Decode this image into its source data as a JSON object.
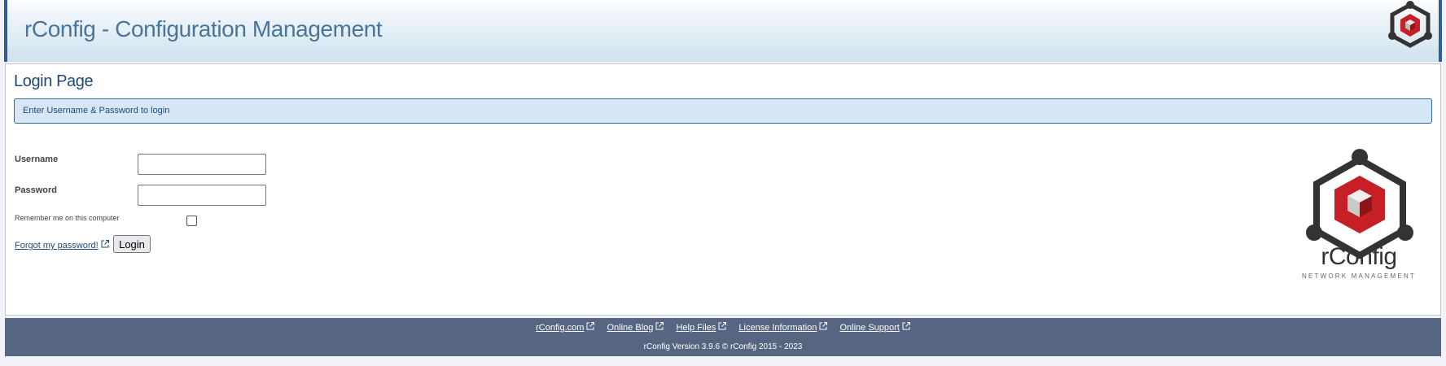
{
  "header": {
    "title": "rConfig - Configuration Management",
    "logo_icon": "rconfig-hexagon-logo-icon"
  },
  "login": {
    "page_title": "Login Page",
    "info_message": "Enter Username & Password to login",
    "username_label": "Username",
    "username_value": "",
    "password_label": "Password",
    "password_value": "",
    "remember_label": "Remember me on this computer",
    "remember_checked": false,
    "forgot_link": "Forgot my password!",
    "login_button": "Login",
    "logo_word": "rConfig",
    "logo_subtitle": "NETWORK MANAGEMENT"
  },
  "footer": {
    "links": [
      {
        "label": "rConfig.com"
      },
      {
        "label": "Online Blog"
      },
      {
        "label": "Help Files"
      },
      {
        "label": "License Information"
      },
      {
        "label": "Online Support"
      }
    ],
    "version_text": "rConfig Version 3.9.6   © rConfig 2015 - 2023"
  },
  "colors": {
    "accent": "#2d5d94",
    "footer_bg": "#556582",
    "info_bg": "#d6e6f4",
    "logo_red": "#c62026"
  }
}
